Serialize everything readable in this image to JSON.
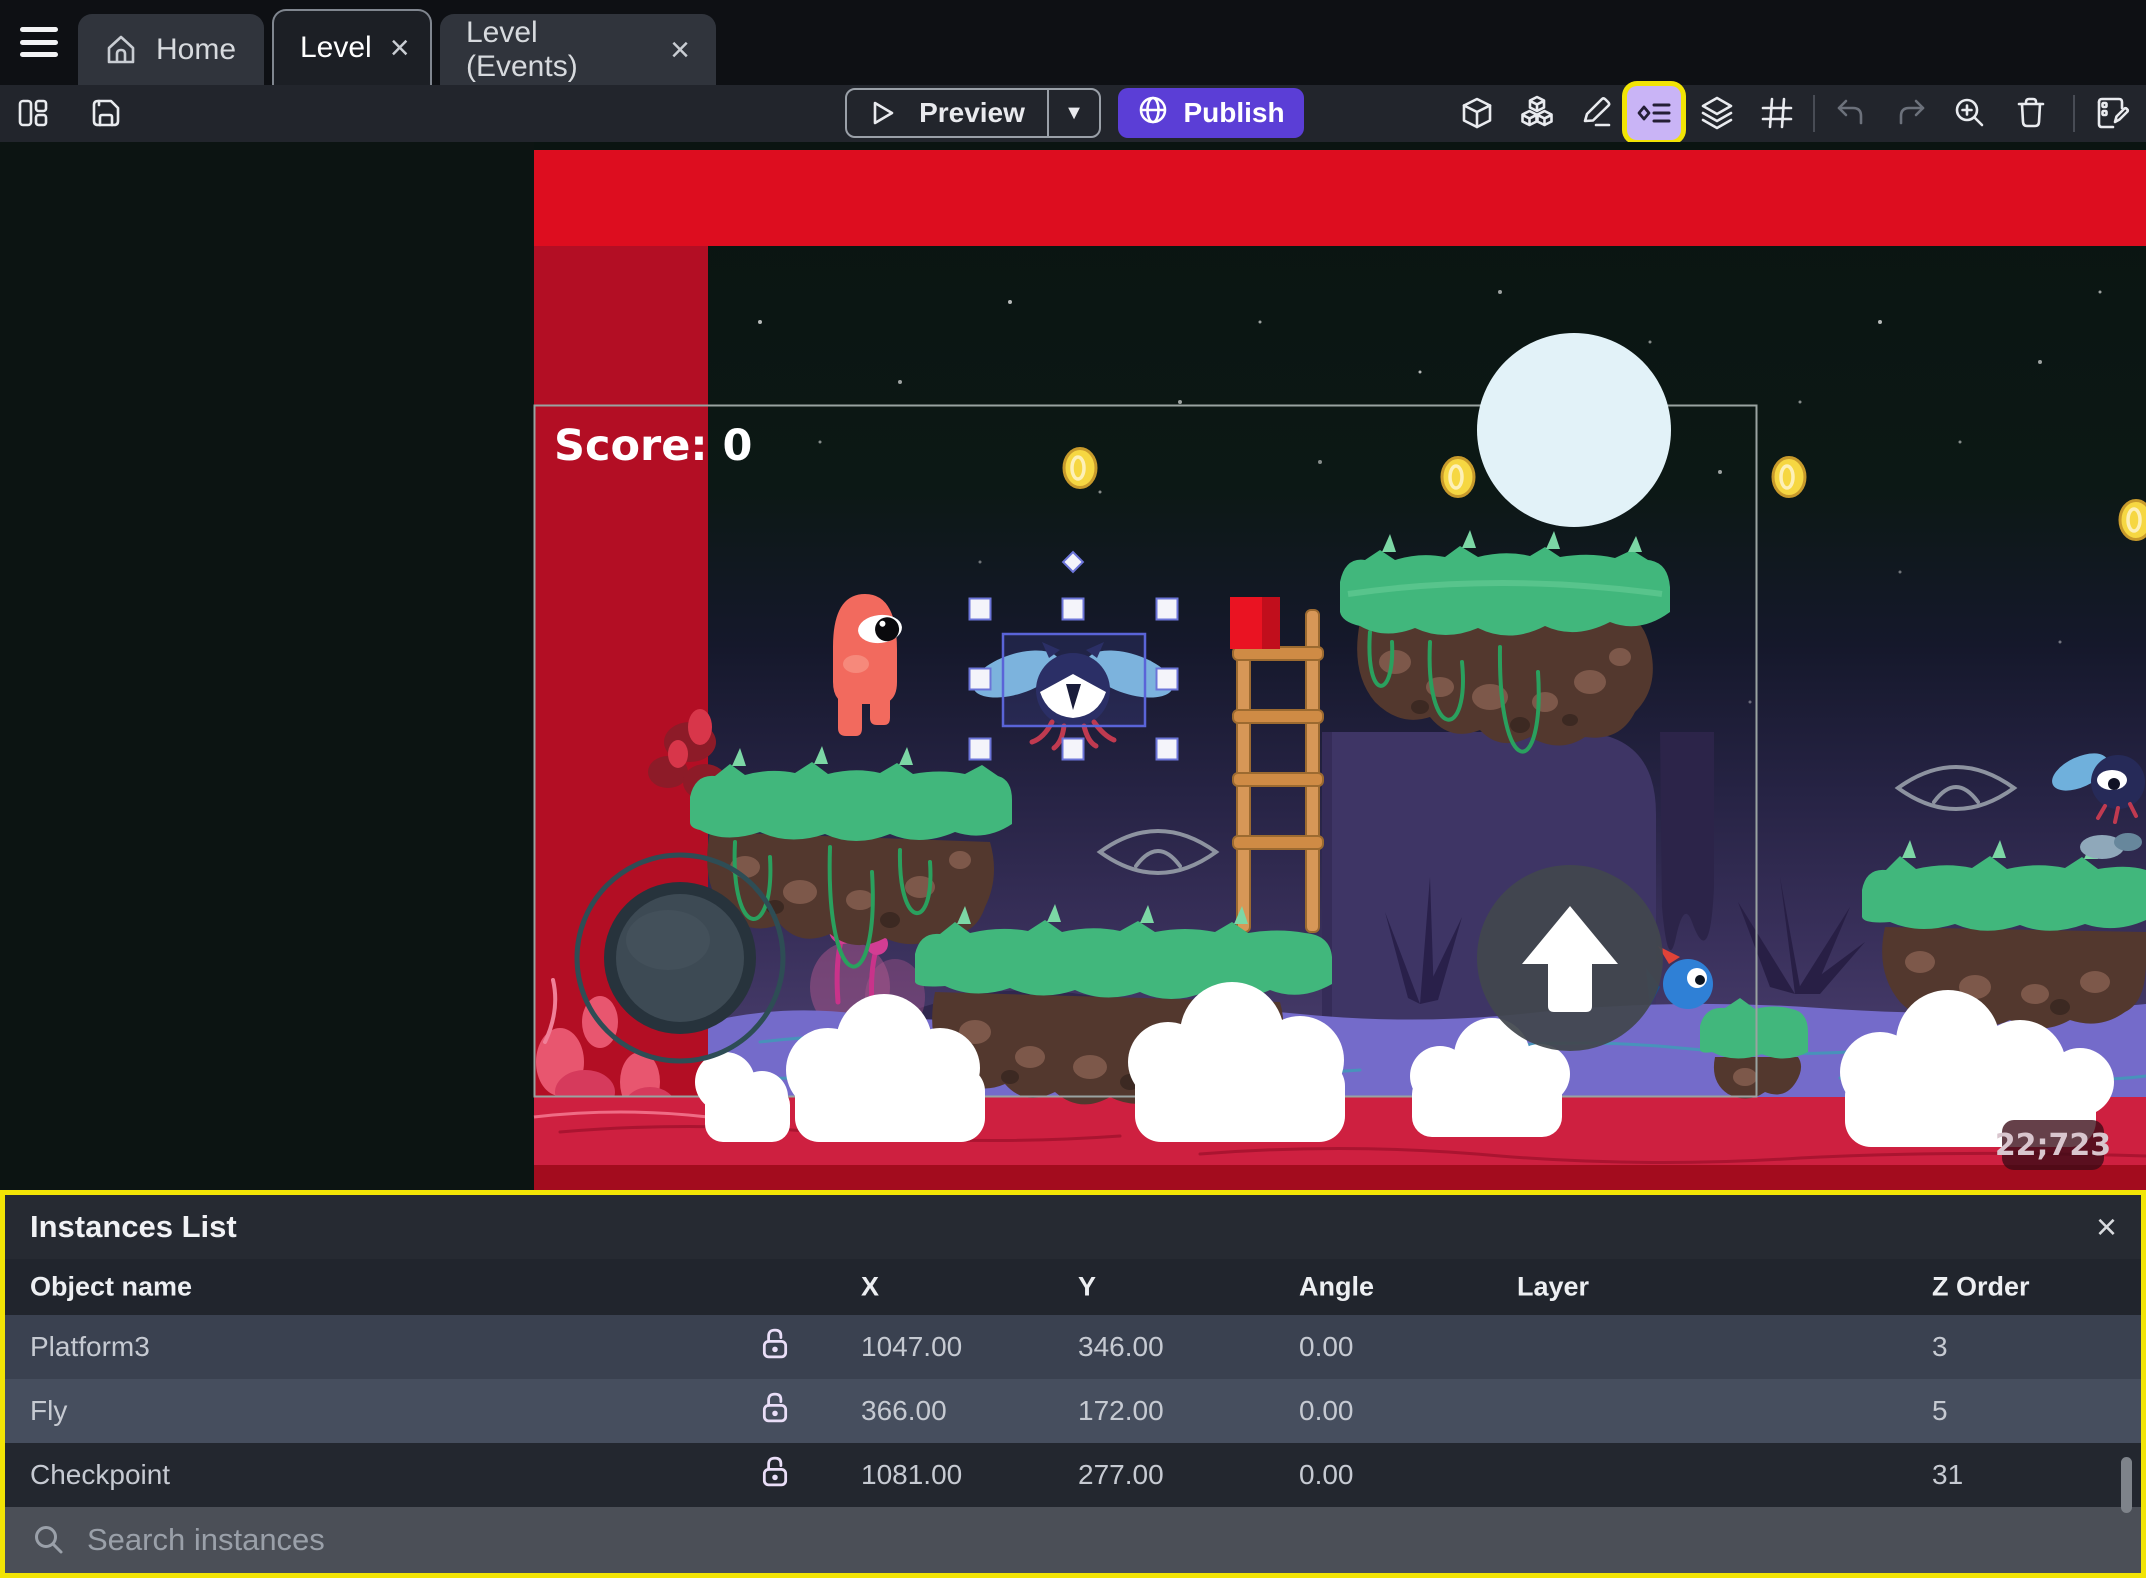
{
  "tabs": {
    "home": "Home",
    "level": "Level",
    "level_events": "Level (Events)"
  },
  "toolbar": {
    "preview_label": "Preview",
    "publish_label": "Publish"
  },
  "icons": {
    "hamburger": "menu",
    "home": "house",
    "close": "×",
    "caret_down": "▼",
    "layout": "editor-layout",
    "save": "floppy-disk",
    "play": "play-triangle",
    "globe": "globe",
    "cube": "object-cube",
    "cubes": "object-groups",
    "pencil": "edit-properties",
    "instances_list": "diamond-list",
    "layers": "stacked-layers",
    "grid": "grid-hash",
    "undo": "undo-arrow",
    "redo": "redo-arrow",
    "zoom_in": "magnifier-plus",
    "trash": "trash-bin",
    "edit_events": "sheet-pencil",
    "search": "magnifier",
    "lock_open": "unlocked-padlock"
  },
  "scene": {
    "score_label": "Score: 0",
    "coords_badge": "22;723"
  },
  "panel": {
    "title": "Instances List",
    "columns": {
      "name": "Object name",
      "x": "X",
      "y": "Y",
      "angle": "Angle",
      "layer": "Layer",
      "z": "Z Order"
    },
    "rows": [
      {
        "name": "Platform3",
        "x": "1047.00",
        "y": "346.00",
        "angle": "0.00",
        "layer": "",
        "z": "3"
      },
      {
        "name": "Fly",
        "x": "366.00",
        "y": "172.00",
        "angle": "0.00",
        "layer": "",
        "z": "5"
      },
      {
        "name": "Checkpoint",
        "x": "1081.00",
        "y": "277.00",
        "angle": "0.00",
        "layer": "",
        "z": "31"
      }
    ],
    "search_placeholder": "Search instances"
  },
  "colors": {
    "publish_purple": "#5b3ed6",
    "highlight_yellow": "#f2e405",
    "selection_blue": "#5a64d8",
    "hud_red": "#dd0d1f",
    "water_purple": "#746bca"
  }
}
